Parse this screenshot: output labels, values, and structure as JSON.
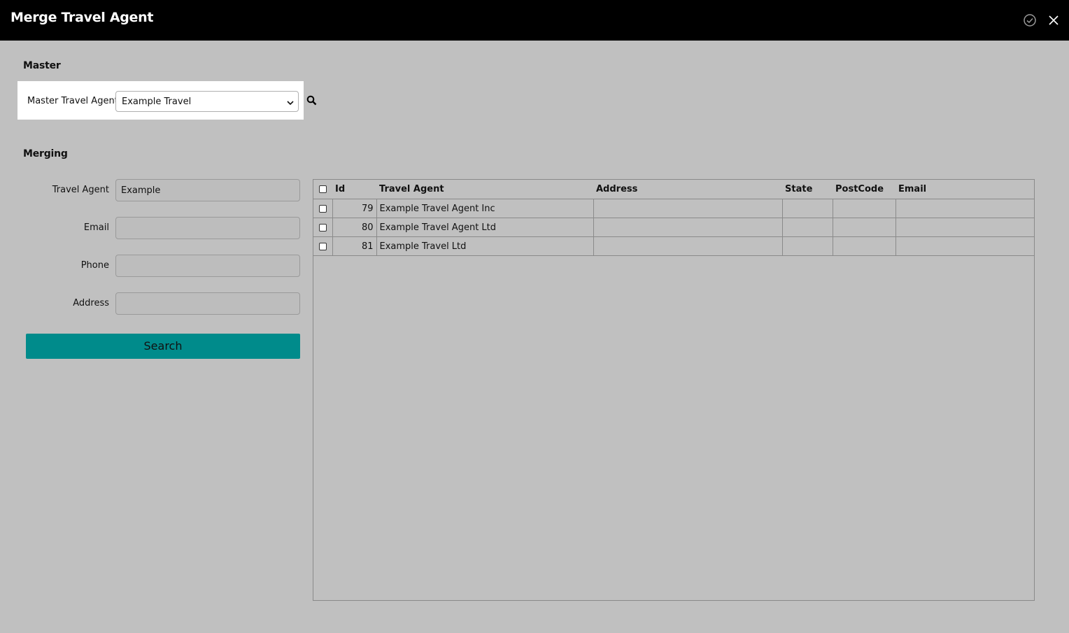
{
  "window": {
    "title": "Merge Travel Agent",
    "icons": [
      "check-circle-icon",
      "close-icon"
    ]
  },
  "master": {
    "heading": "Master",
    "field_label": "Master Travel Agent",
    "selected_value": "Example Travel"
  },
  "merging": {
    "heading": "Merging",
    "fields": [
      {
        "label": "Travel Agent",
        "value": "Example"
      },
      {
        "label": "Email",
        "value": ""
      },
      {
        "label": "Phone",
        "value": ""
      },
      {
        "label": "Address",
        "value": ""
      }
    ],
    "search_label": "Search"
  },
  "table": {
    "headers": [
      "Id",
      "Travel Agent",
      "Address",
      "State",
      "PostCode",
      "Email"
    ],
    "rows": [
      {
        "id": "79",
        "agent": "Example Travel Agent Inc",
        "address": "",
        "state": "",
        "postcode": "",
        "email": ""
      },
      {
        "id": "80",
        "agent": "Example Travel Agent Ltd",
        "address": "",
        "state": "",
        "postcode": "",
        "email": ""
      },
      {
        "id": "81",
        "agent": "Example Travel Ltd",
        "address": "",
        "state": "",
        "postcode": "",
        "email": ""
      }
    ]
  },
  "colors": {
    "accent": "#008b8b",
    "titlebar": "#000000",
    "background": "#c0c0c0"
  }
}
